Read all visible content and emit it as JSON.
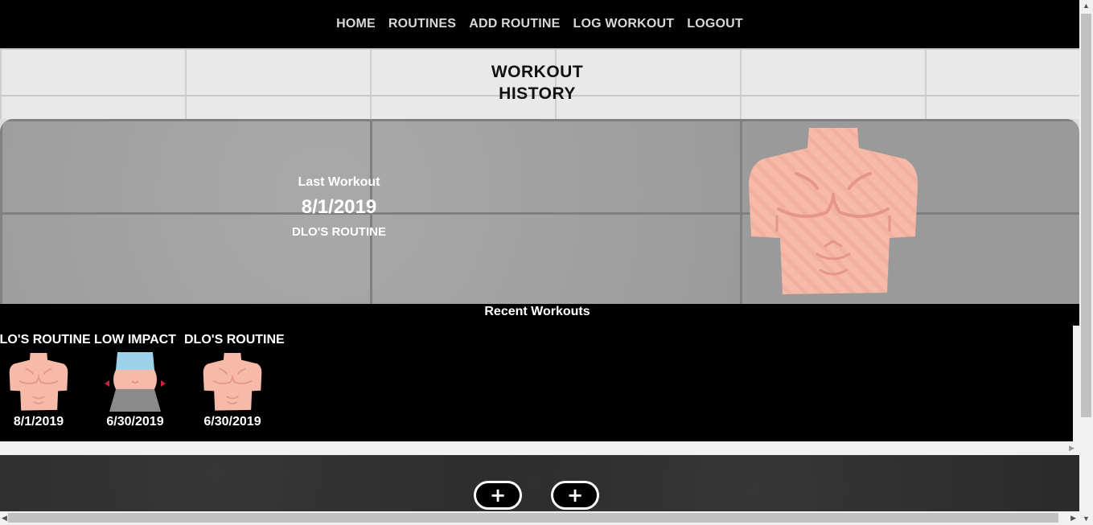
{
  "nav": {
    "home": "HOME",
    "routines": "ROUTINES",
    "add_routine": "ADD ROUTINE",
    "log_workout": "LOG WORKOUT",
    "logout": "LOGOUT"
  },
  "page": {
    "title": "WORKOUT\nHISTORY"
  },
  "last_workout": {
    "label": "Last Workout",
    "date": "8/1/2019",
    "routine": "DLO'S ROUTINE",
    "icon": "torso-icon"
  },
  "recent": {
    "title": "Recent Workouts",
    "items": [
      {
        "name": "DLO'S ROUTINE",
        "date": "8/1/2019",
        "icon": "torso-icon"
      },
      {
        "name": "LOW IMPACT",
        "date": "6/30/2019",
        "icon": "belly-icon"
      },
      {
        "name": "DLO'S ROUTINE",
        "date": "6/30/2019",
        "icon": "torso-icon"
      }
    ]
  },
  "actions": {
    "add_1": "+",
    "add_2": "+"
  },
  "colors": {
    "skin": "#f7b9a8",
    "skin_line": "#e5968a",
    "shirt_blue": "#9dd2ea",
    "pants_grey": "#8a8a8a",
    "arrow_red": "#d0213a"
  }
}
